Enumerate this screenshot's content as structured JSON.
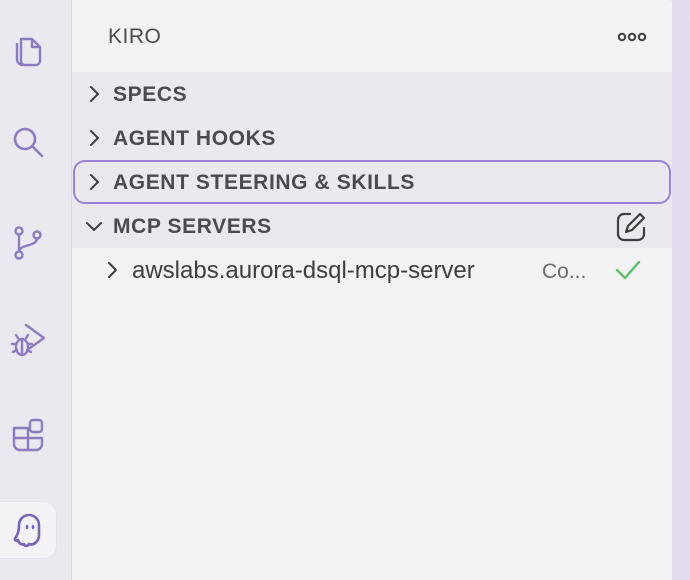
{
  "activity_bar": {
    "icons": [
      "explorer-icon",
      "search-icon",
      "source-control-icon",
      "run-debug-icon",
      "extensions-icon",
      "kiro-ghost-icon"
    ],
    "active": "kiro-ghost-icon"
  },
  "sidebar": {
    "title": "KIRO",
    "sections": [
      {
        "label": "SPECS",
        "expanded": false
      },
      {
        "label": "AGENT HOOKS",
        "expanded": false
      },
      {
        "label": "AGENT STEERING & SKILLS",
        "expanded": false,
        "focused": true
      },
      {
        "label": "MCP SERVERS",
        "expanded": true
      }
    ],
    "mcp_servers": [
      {
        "name": "awslabs.aurora-dsql-mcp-server",
        "status": "Co...",
        "connected": true
      }
    ]
  },
  "colors": {
    "accent": "#9a82d8",
    "check": "#5cbf6a",
    "icon": "#7a63b8"
  }
}
